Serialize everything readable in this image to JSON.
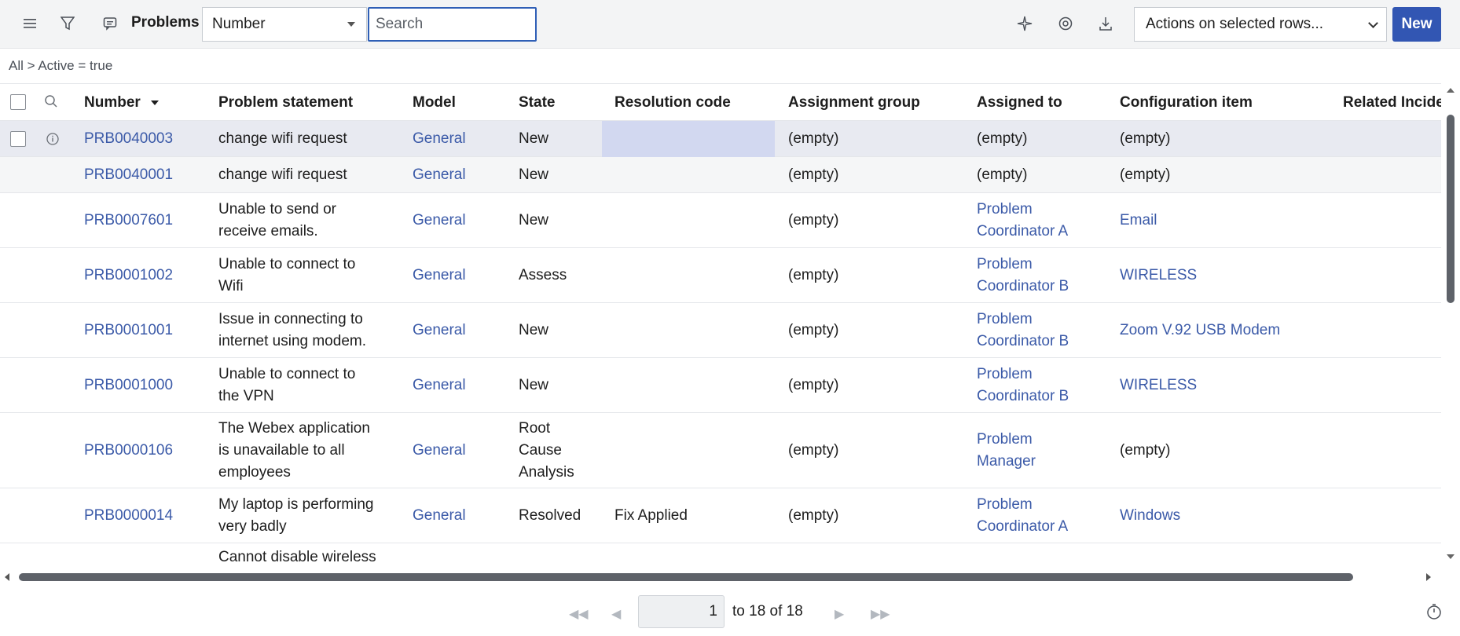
{
  "header": {
    "title": "Problems",
    "search_field": "Number",
    "search_placeholder": "Search",
    "actions_label": "Actions on selected rows...",
    "new_label": "New"
  },
  "breadcrumb": "All > Active = true",
  "columns": {
    "number": "Number",
    "statement": "Problem statement",
    "model": "Model",
    "state": "State",
    "resolution": "Resolution code",
    "group": "Assignment group",
    "assigned": "Assigned to",
    "ci": "Configuration item",
    "related": "Related Incide"
  },
  "rows": [
    {
      "number": "PRB0040003",
      "statement": [
        "change wifi request"
      ],
      "model": "General",
      "state": [
        "New"
      ],
      "resolution": "",
      "group": "(empty)",
      "assigned": [
        "(empty)"
      ],
      "ci": "(empty)"
    },
    {
      "number": "PRB0040001",
      "statement": [
        "change wifi request"
      ],
      "model": "General",
      "state": [
        "New"
      ],
      "resolution": "",
      "group": "(empty)",
      "assigned": [
        "(empty)"
      ],
      "ci": "(empty)"
    },
    {
      "number": "PRB0007601",
      "statement": [
        "Unable to send or",
        "receive emails."
      ],
      "model": "General",
      "state": [
        "New"
      ],
      "resolution": "",
      "group": "(empty)",
      "assigned": [
        "Problem",
        "Coordinator A"
      ],
      "ci": "Email"
    },
    {
      "number": "PRB0001002",
      "statement": [
        "Unable to connect to",
        "Wifi"
      ],
      "model": "General",
      "state": [
        "Assess"
      ],
      "resolution": "",
      "group": "(empty)",
      "assigned": [
        "Problem",
        "Coordinator B"
      ],
      "ci": "WIRELESS"
    },
    {
      "number": "PRB0001001",
      "statement": [
        "Issue in connecting to",
        "internet using modem."
      ],
      "model": "General",
      "state": [
        "New"
      ],
      "resolution": "",
      "group": "(empty)",
      "assigned": [
        "Problem",
        "Coordinator B"
      ],
      "ci": "Zoom V.92 USB Modem"
    },
    {
      "number": "PRB0001000",
      "statement": [
        "Unable to connect to",
        "the VPN"
      ],
      "model": "General",
      "state": [
        "New"
      ],
      "resolution": "",
      "group": "(empty)",
      "assigned": [
        "Problem",
        "Coordinator B"
      ],
      "ci": "WIRELESS"
    },
    {
      "number": "PRB0000106",
      "statement": [
        "The Webex application",
        "is unavailable to all",
        "employees"
      ],
      "model": "General",
      "state": [
        "Root",
        "Cause",
        "Analysis"
      ],
      "resolution": "",
      "group": "(empty)",
      "assigned": [
        "Problem",
        "Manager"
      ],
      "ci": "(empty)"
    },
    {
      "number": "PRB0000014",
      "statement": [
        "My laptop is performing",
        "very badly"
      ],
      "model": "General",
      "state": [
        "Resolved"
      ],
      "resolution": "Fix Applied",
      "group": "(empty)",
      "assigned": [
        "Problem",
        "Coordinator A"
      ],
      "ci": "Windows"
    },
    {
      "number": "",
      "statement": [
        "Cannot disable wireless"
      ],
      "model": "",
      "state": [
        ""
      ],
      "resolution": "",
      "group": "",
      "assigned": [
        ""
      ],
      "ci": ""
    }
  ],
  "pagination": {
    "current_page": "1",
    "range_text": "to 18 of 18"
  }
}
